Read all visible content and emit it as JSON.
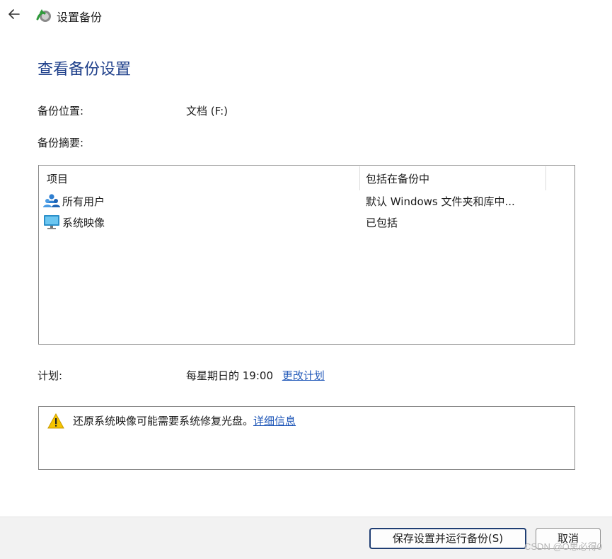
{
  "window": {
    "title": "设置备份"
  },
  "page": {
    "heading": "查看备份设置"
  },
  "backup_location": {
    "label": "备份位置:",
    "value": "文档 (F:)"
  },
  "summary": {
    "label": "备份摘要:",
    "columns": [
      "项目",
      "包括在备份中"
    ],
    "rows": [
      {
        "item": "所有用户",
        "included": "默认 Windows 文件夹和库中...",
        "icon": "users-icon"
      },
      {
        "item": "系统映像",
        "included": "已包括",
        "icon": "monitor-icon"
      }
    ]
  },
  "schedule": {
    "label": "计划:",
    "value": "每星期日的 19:00",
    "change_link": "更改计划"
  },
  "notice": {
    "text": "还原系统映像可能需要系统修复光盘。",
    "link": "详细信息",
    "icon": "warning-icon"
  },
  "buttons": {
    "save_run": "保存设置并运行备份(S)",
    "cancel": "取消"
  },
  "watermark": "CSDN @O思必得0",
  "colors": {
    "heading": "#1e3f8a",
    "link": "#1f57b8",
    "primary_border": "#1f3e73",
    "footer_bg": "#f2f2f2"
  }
}
